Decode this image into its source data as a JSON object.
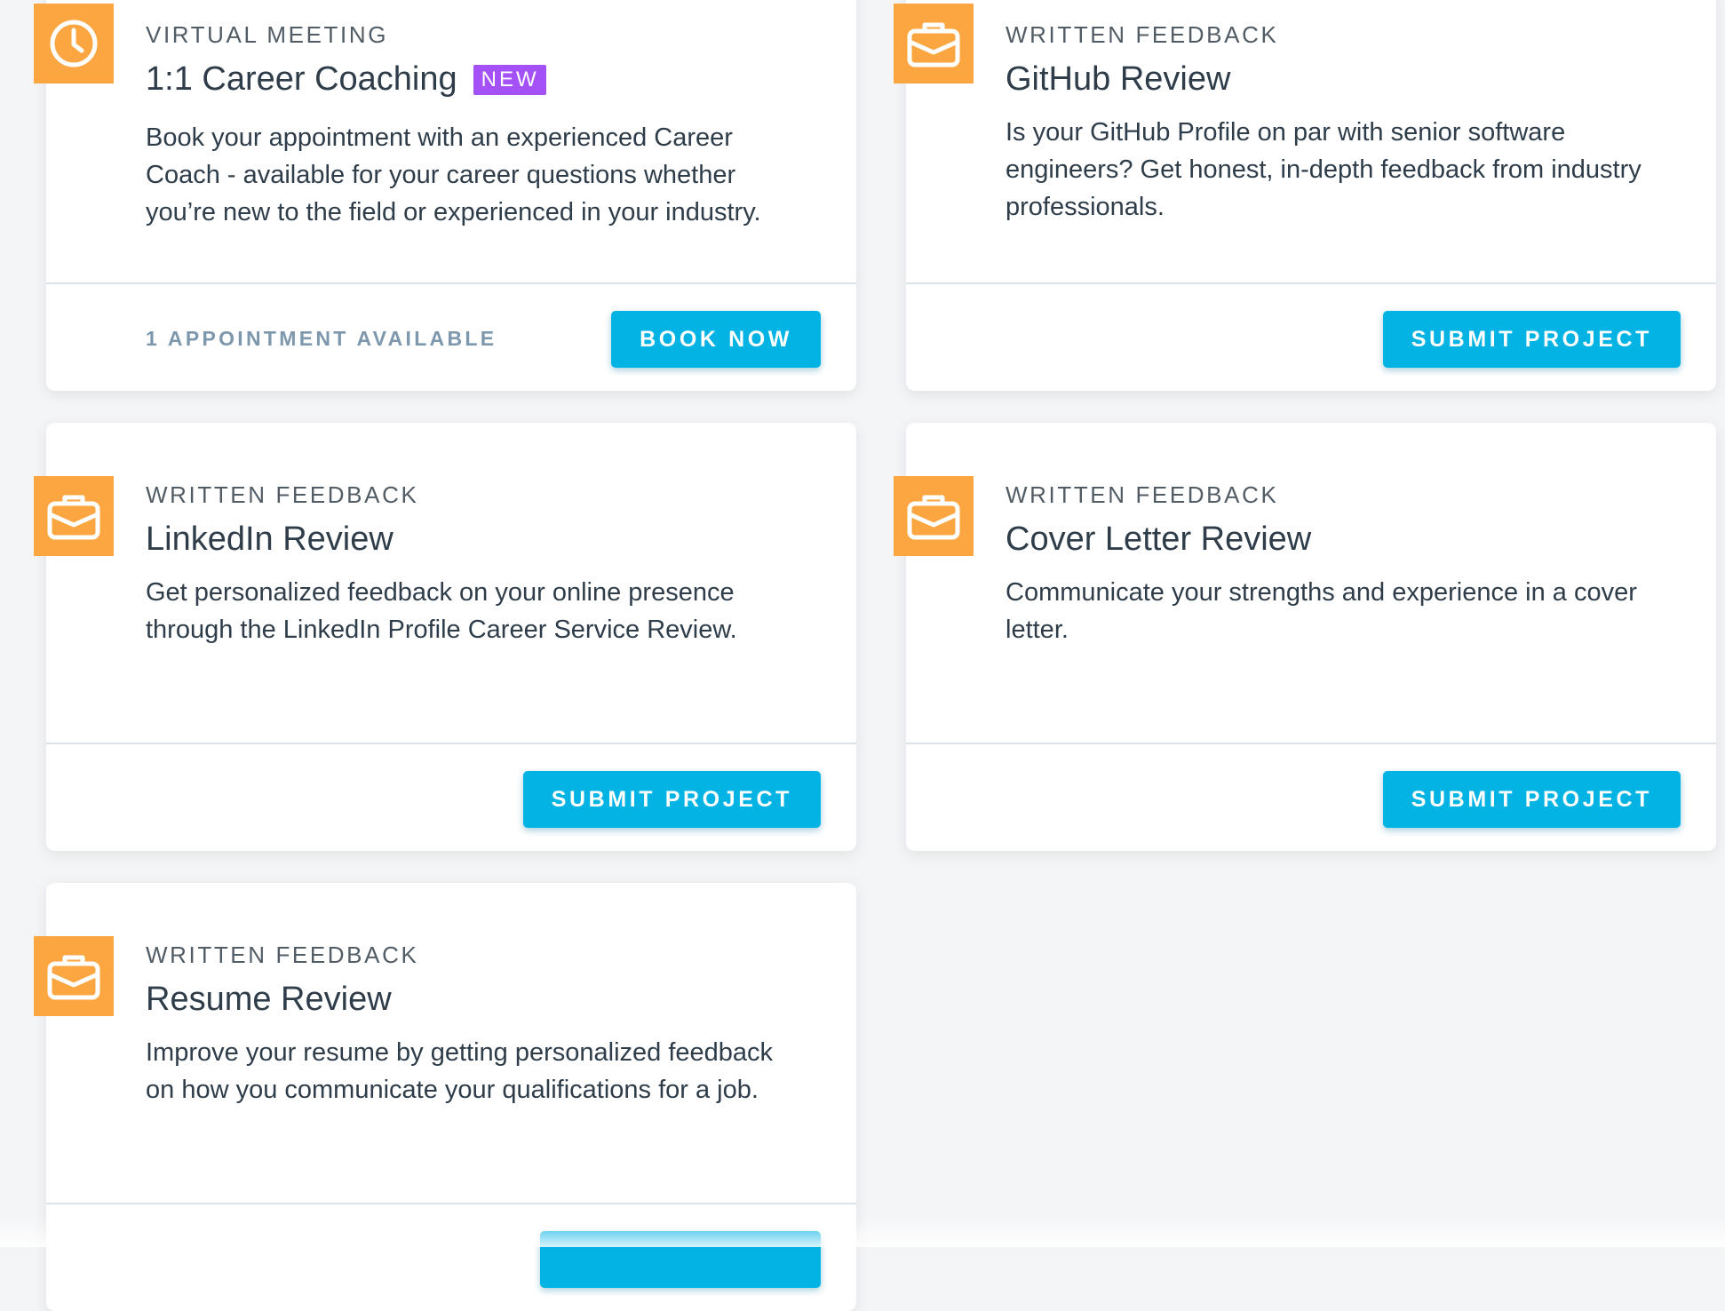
{
  "cards": [
    {
      "id": "career-coaching",
      "kicker": "VIRTUAL MEETING",
      "title": "1:1 Career Coaching",
      "badge": "NEW",
      "icon": "clock-icon",
      "description": "Book your appointment with an experienced Career Coach - available for your career questions whether you’re new to the field or experienced in your industry.",
      "footer_note": "1 APPOINTMENT AVAILABLE",
      "button_label": "BOOK NOW"
    },
    {
      "id": "github-review",
      "kicker": "WRITTEN FEEDBACK",
      "title": "GitHub Review",
      "icon": "briefcase-icon",
      "description": "Is your GitHub Profile on par with senior software engineers? Get honest, in-depth feedback from industry professionals.",
      "button_label": "SUBMIT PROJECT"
    },
    {
      "id": "linkedin-review",
      "kicker": "WRITTEN FEEDBACK",
      "title": "LinkedIn Review",
      "icon": "briefcase-icon",
      "description": "Get personalized feedback on your online presence through the LinkedIn Profile Career Service Review.",
      "button_label": "SUBMIT PROJECT"
    },
    {
      "id": "cover-letter-review",
      "kicker": "WRITTEN FEEDBACK",
      "title": "Cover Letter Review",
      "icon": "briefcase-icon",
      "description": "Communicate your strengths and experience in a cover letter.",
      "button_label": "SUBMIT PROJECT"
    },
    {
      "id": "resume-review",
      "kicker": "WRITTEN FEEDBACK",
      "title": "Resume Review",
      "icon": "briefcase-icon",
      "description": "Improve your resume by getting personalized feedback on how you communicate your qualifications for a job.",
      "button_label": ""
    }
  ],
  "colors": {
    "icon_background": "#fca642",
    "button": "#02b3e4",
    "badge": "#a451f7",
    "heading_text": "#2e3d49",
    "muted_text": "#7d97ad"
  }
}
